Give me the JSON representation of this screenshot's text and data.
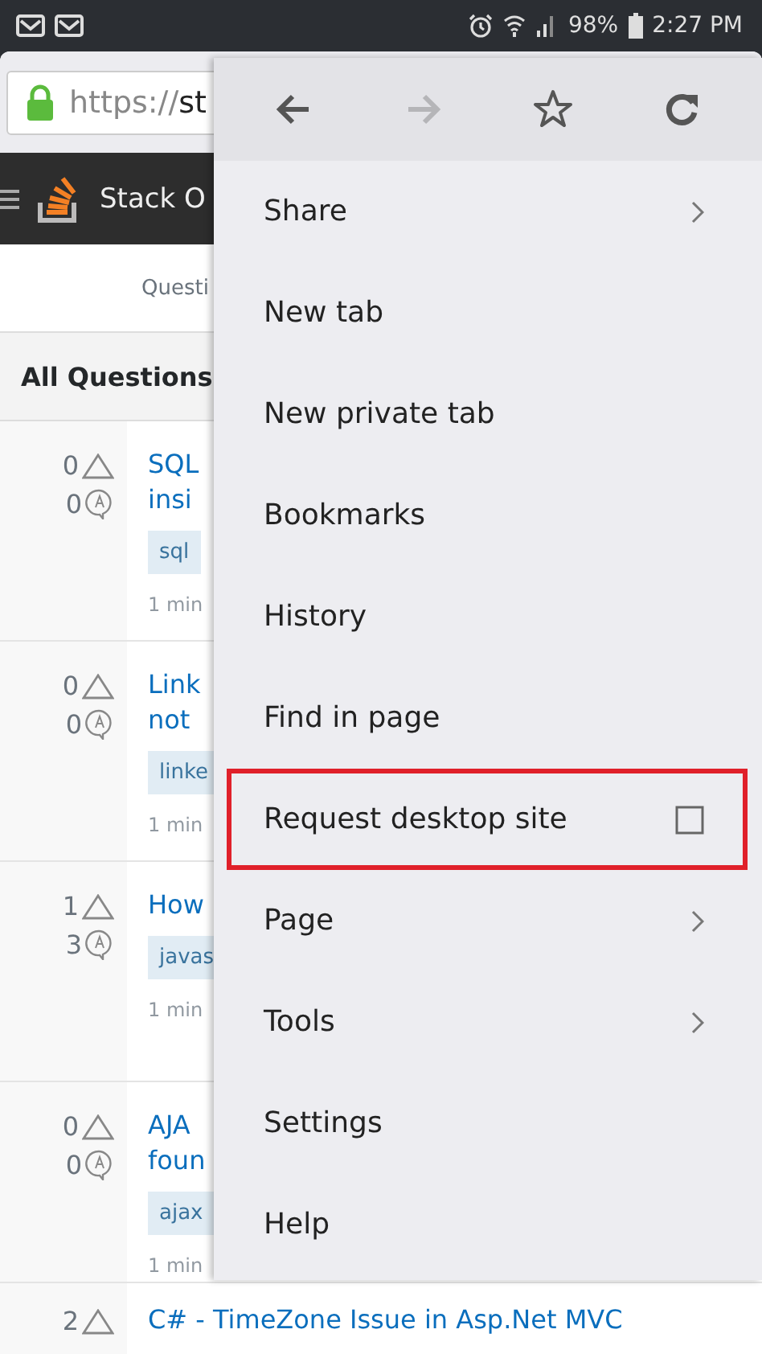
{
  "status_bar": {
    "battery": "98%",
    "time": "2:27 PM"
  },
  "address_bar": {
    "scheme": "https://",
    "host": "st"
  },
  "site_header": {
    "title": "Stack O"
  },
  "sub_nav": {
    "label": "Questi"
  },
  "section": {
    "title": "All Questions"
  },
  "questions": [
    {
      "votes": "0",
      "answers": "0",
      "title_lines": [
        "SQL",
        "insi"
      ],
      "tag": "sql",
      "time": "1 min"
    },
    {
      "votes": "0",
      "answers": "0",
      "title_lines": [
        "Link",
        "not"
      ],
      "tag": "linke",
      "time": "1 min"
    },
    {
      "votes": "1",
      "answers": "3",
      "title_lines": [
        "How"
      ],
      "tag": "javas",
      "time": "1 min"
    },
    {
      "votes": "0",
      "answers": "0",
      "title_lines": [
        "AJA",
        "foun"
      ],
      "tag": "ajax",
      "time": "1 min"
    },
    {
      "votes": "2",
      "title_lines": [
        "C# - TimeZone Issue in Asp.Net MVC"
      ]
    }
  ],
  "menu": {
    "nav": [
      {
        "kind": "back",
        "disabled": false
      },
      {
        "kind": "forward",
        "disabled": true
      },
      {
        "kind": "star",
        "disabled": false
      },
      {
        "kind": "reload",
        "disabled": false
      }
    ],
    "items": [
      {
        "label": "Share",
        "kind": "submenu",
        "highlighted": false
      },
      {
        "label": "New tab",
        "kind": "plain",
        "highlighted": false
      },
      {
        "label": "New private tab",
        "kind": "plain",
        "highlighted": false
      },
      {
        "label": "Bookmarks",
        "kind": "plain",
        "highlighted": false
      },
      {
        "label": "History",
        "kind": "plain",
        "highlighted": false
      },
      {
        "label": "Find in page",
        "kind": "plain",
        "highlighted": false
      },
      {
        "label": "Request desktop site",
        "kind": "checkbox",
        "checked": false,
        "highlighted": true
      },
      {
        "label": "Page",
        "kind": "submenu",
        "highlighted": false
      },
      {
        "label": "Tools",
        "kind": "submenu",
        "highlighted": false
      },
      {
        "label": "Settings",
        "kind": "plain",
        "highlighted": false
      },
      {
        "label": "Help",
        "kind": "plain",
        "highlighted": false
      }
    ]
  }
}
